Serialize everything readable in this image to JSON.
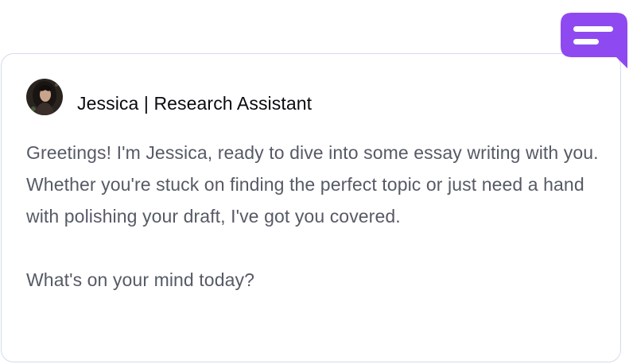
{
  "card": {
    "author": "Jessica | Research Assistant",
    "message": {
      "paragraph1": "Greetings! I'm Jessica, ready to dive into some essay writing with you. Whether you're stuck on finding the perfect topic or just need a hand with polishing your draft, I've got you covered.",
      "paragraph2": "What's on your mind today?"
    }
  },
  "icons": {
    "chat": "chat-bubble-icon",
    "avatar": "avatar-photo"
  },
  "colors": {
    "accent": "#8e4af0",
    "border": "#d3dceb",
    "text": "#565a66",
    "name": "#0b0b0f"
  }
}
